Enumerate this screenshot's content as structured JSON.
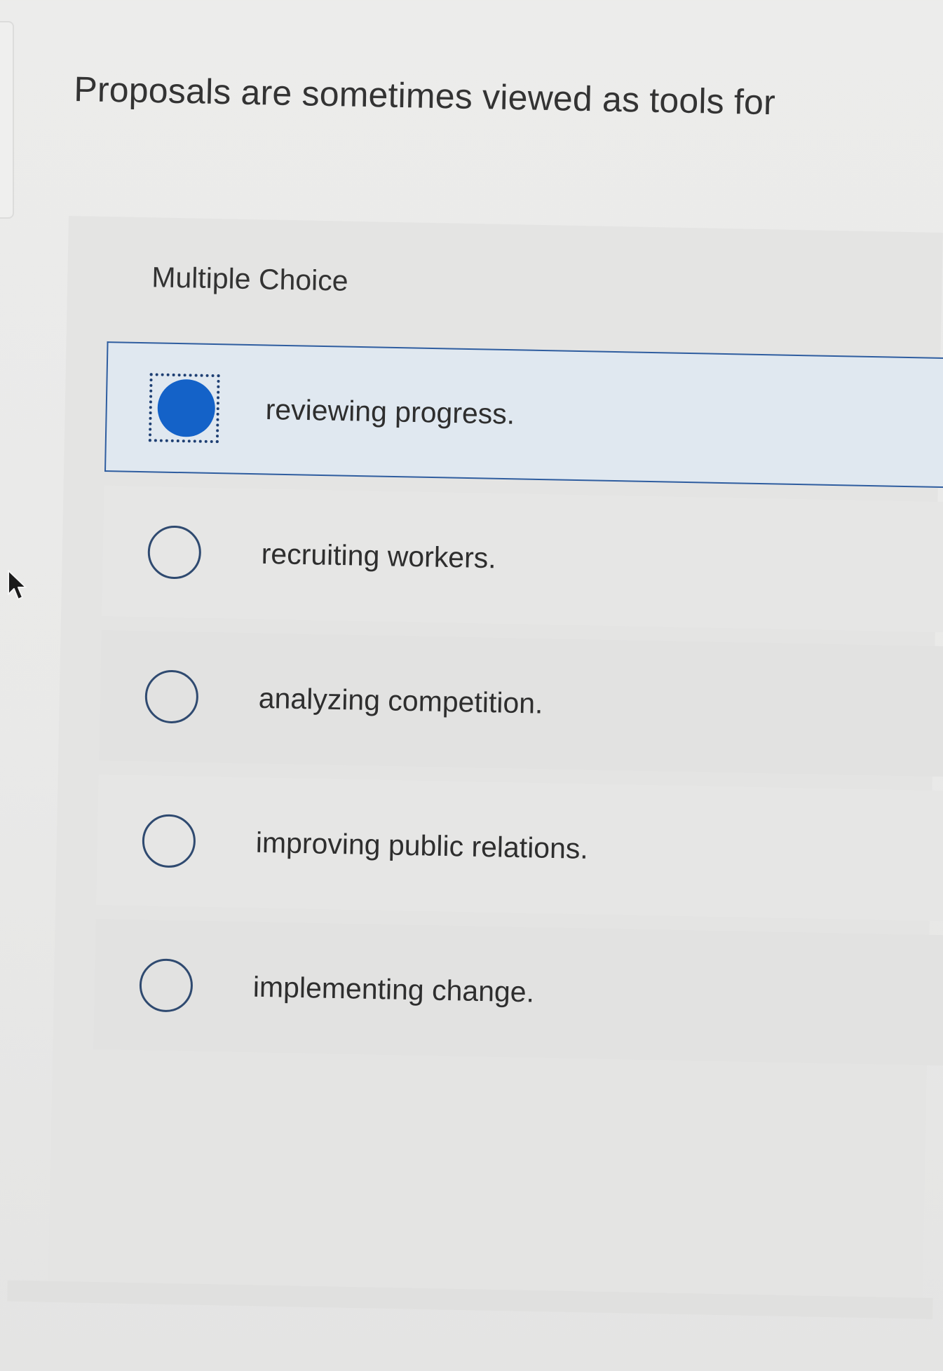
{
  "question": {
    "title": "Proposals are sometimes viewed as tools for",
    "type_label": "Multiple Choice"
  },
  "options": [
    {
      "label": "reviewing progress.",
      "selected": true
    },
    {
      "label": "recruiting workers.",
      "selected": false
    },
    {
      "label": "analyzing competition.",
      "selected": false
    },
    {
      "label": "improving public relations.",
      "selected": false
    },
    {
      "label": "implementing change.",
      "selected": false
    }
  ],
  "colors": {
    "selected_fill": "#1462c8",
    "selected_border": "#2f5d9f",
    "selected_background": "#e0e8f0",
    "radio_outline": "#2f4a70"
  },
  "icons": {
    "cursor": "mouse-pointer-icon"
  }
}
